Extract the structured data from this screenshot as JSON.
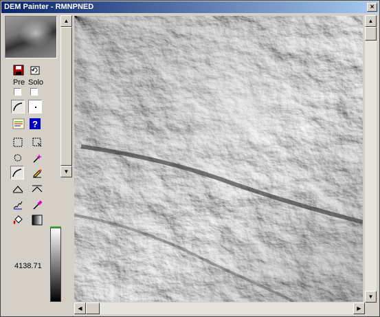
{
  "window": {
    "title": "DEM Painter - RMNPNED",
    "close_glyph": "×"
  },
  "toolbar": {
    "pre_label": "Pre",
    "solo_label": "Solo",
    "pre_checked": false,
    "solo_checked": false
  },
  "elevation": {
    "value": "4138.71"
  },
  "icons": [
    "save-icon",
    "undo-icon",
    "line-curve-icon",
    "dot-icon",
    "legend-icon",
    "help-icon",
    "rect-select-icon",
    "rect-select-plus-icon",
    "lasso-icon",
    "magic-wand-icon",
    "line-tool-icon",
    "pencil-eraser-icon",
    "raise-icon",
    "lower-icon",
    "smooth-icon",
    "dropper-icon",
    "paint-bucket-icon",
    "gradient-icon"
  ],
  "colors": {
    "titlebar_start": "#0a246a",
    "titlebar_end": "#a6caf0",
    "colorbar_top": "#40c040"
  }
}
